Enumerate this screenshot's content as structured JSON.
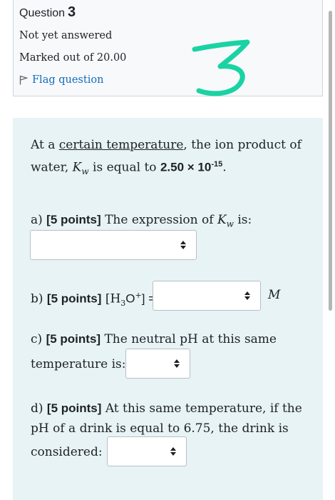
{
  "info": {
    "question_label": "Question",
    "question_number": "3",
    "state": "Not yet answered",
    "grade": "Marked out of 20.00",
    "flag_label": "Flag question"
  },
  "handwritten_mark": "3",
  "intro": {
    "line1_pre": "At a ",
    "line1_underlined": "certain temperature",
    "line1_post": ", the ion product of",
    "line2_pre": "water, ",
    "kw_k": "K",
    "kw_w": "w",
    "line2_mid": " is equal to ",
    "value_bold": "2.50 × 10",
    "value_exp": "-15",
    "line2_end": "."
  },
  "parts": {
    "a": {
      "label": "a) ",
      "points": "[5 points]",
      "text_pre": " The expression of ",
      "k": "K",
      "w": "w",
      "text_post": " is:"
    },
    "b": {
      "label": "b) ",
      "points": "[5 points]",
      "text_pre": " [H",
      "sub3": "3",
      "o": "O",
      "sup_plus": "+",
      "text_post": "] =",
      "unit": "M"
    },
    "c": {
      "label": "c) ",
      "points": "[5 points]",
      "line1": " The neutral pH at this same",
      "line2": "temperature is:"
    },
    "d": {
      "label": "d) ",
      "points": "[5 points]",
      "line1": " At this same temperature, if the",
      "line2": "pH of a drink is equal to 6.75, the drink is",
      "line3": "considered:"
    }
  },
  "selects": {
    "a_value": "",
    "b_value": "",
    "c_value": "",
    "d_value": ""
  },
  "colors": {
    "flag_link": "#0f6cbf",
    "content_bg": "#e7f3f5",
    "handmark": "#19d3a4"
  }
}
